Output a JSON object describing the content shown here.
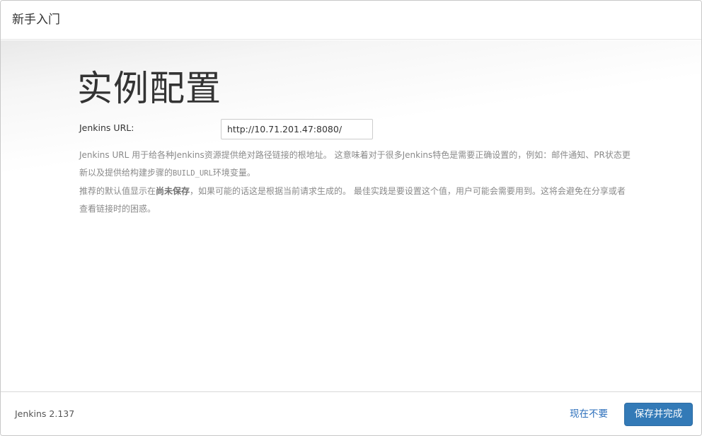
{
  "header": {
    "title": "新手入门"
  },
  "main": {
    "heading": "实例配置",
    "url_label": "Jenkins URL:",
    "url_value": "http://10.71.201.47:8080/",
    "help_line1_a": "Jenkins URL 用于给各种Jenkins资源提供绝对路径链接的根地址。 这意味着对于很多Jenkins特色是需要正确设置的，例如：邮件通知、PR状态更新以及提供给构建步骤的",
    "help_line1_code": "BUILD_URL",
    "help_line1_b": "环境变量。",
    "help_line2_a": "推荐的默认值显示在",
    "help_line2_bold": "尚未保存",
    "help_line2_b": "，如果可能的话这是根据当前请求生成的。 最佳实践是要设置这个值，用户可能会需要用到。这将会避免在分享或者查看链接时的困惑。"
  },
  "footer": {
    "version": "Jenkins 2.137",
    "skip_label": "现在不要",
    "save_label": "保存并完成"
  },
  "colors": {
    "primary_button": "#337ab7",
    "link": "#2a6ebb"
  }
}
